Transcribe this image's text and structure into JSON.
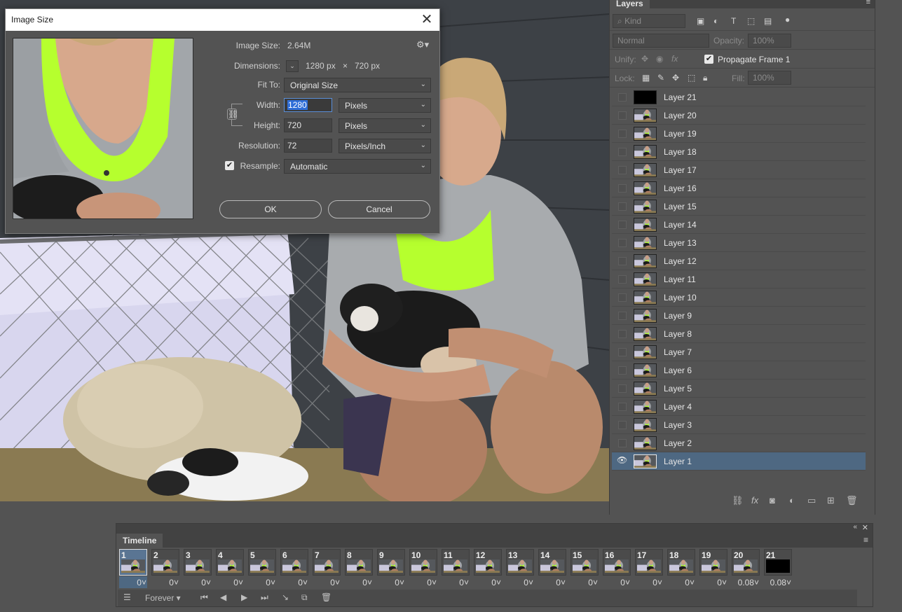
{
  "dialog": {
    "title": "Image Size",
    "image_size_label": "Image Size:",
    "image_size_value": "2.64M",
    "dimensions_label": "Dimensions:",
    "dimensions_width": "1280 px",
    "dimensions_x": "×",
    "dimensions_height": "720 px",
    "fit_to_label": "Fit To:",
    "fit_to_value": "Original Size",
    "width_label": "Width:",
    "width_value": "1280",
    "width_unit": "Pixels",
    "height_label": "Height:",
    "height_value": "720",
    "height_unit": "Pixels",
    "resolution_label": "Resolution:",
    "resolution_value": "72",
    "resolution_unit": "Pixels/Inch",
    "resample_label": "Resample:",
    "resample_value": "Automatic",
    "ok_label": "OK",
    "cancel_label": "Cancel"
  },
  "layers_panel": {
    "title": "Layers",
    "kind_placeholder": "Kind",
    "blend_mode": "Normal",
    "opacity_label": "Opacity:",
    "opacity_value": "100%",
    "unify_label": "Unify:",
    "propagate_label": "Propagate Frame 1",
    "lock_label": "Lock:",
    "fill_label": "Fill:",
    "fill_value": "100%",
    "layers": [
      {
        "name": "Layer 21",
        "thumb": "black",
        "visible": false
      },
      {
        "name": "Layer 20",
        "thumb": "photo",
        "visible": false
      },
      {
        "name": "Layer 19",
        "thumb": "photo",
        "visible": false
      },
      {
        "name": "Layer 18",
        "thumb": "photo",
        "visible": false
      },
      {
        "name": "Layer 17",
        "thumb": "photo",
        "visible": false
      },
      {
        "name": "Layer 16",
        "thumb": "photo",
        "visible": false
      },
      {
        "name": "Layer 15",
        "thumb": "photo",
        "visible": false
      },
      {
        "name": "Layer 14",
        "thumb": "photo",
        "visible": false
      },
      {
        "name": "Layer 13",
        "thumb": "photo",
        "visible": false
      },
      {
        "name": "Layer 12",
        "thumb": "photo",
        "visible": false
      },
      {
        "name": "Layer 11",
        "thumb": "photo",
        "visible": false
      },
      {
        "name": "Layer 10",
        "thumb": "photo",
        "visible": false
      },
      {
        "name": "Layer 9",
        "thumb": "photo",
        "visible": false
      },
      {
        "name": "Layer 8",
        "thumb": "photo",
        "visible": false
      },
      {
        "name": "Layer 7",
        "thumb": "photo",
        "visible": false
      },
      {
        "name": "Layer 6",
        "thumb": "photo",
        "visible": false
      },
      {
        "name": "Layer 5",
        "thumb": "photo",
        "visible": false
      },
      {
        "name": "Layer 4",
        "thumb": "photo",
        "visible": false
      },
      {
        "name": "Layer 3",
        "thumb": "photo",
        "visible": false
      },
      {
        "name": "Layer 2",
        "thumb": "photo",
        "visible": false
      },
      {
        "name": "Layer 1",
        "thumb": "photo",
        "visible": true,
        "active": true
      }
    ]
  },
  "timeline": {
    "title": "Timeline",
    "loop_value": "Forever",
    "frames": [
      {
        "num": "1",
        "delay": "0",
        "active": true
      },
      {
        "num": "2",
        "delay": "0"
      },
      {
        "num": "3",
        "delay": "0"
      },
      {
        "num": "4",
        "delay": "0"
      },
      {
        "num": "5",
        "delay": "0"
      },
      {
        "num": "6",
        "delay": "0"
      },
      {
        "num": "7",
        "delay": "0"
      },
      {
        "num": "8",
        "delay": "0"
      },
      {
        "num": "9",
        "delay": "0"
      },
      {
        "num": "10",
        "delay": "0"
      },
      {
        "num": "11",
        "delay": "0"
      },
      {
        "num": "12",
        "delay": "0"
      },
      {
        "num": "13",
        "delay": "0"
      },
      {
        "num": "14",
        "delay": "0"
      },
      {
        "num": "15",
        "delay": "0"
      },
      {
        "num": "16",
        "delay": "0"
      },
      {
        "num": "17",
        "delay": "0"
      },
      {
        "num": "18",
        "delay": "0"
      },
      {
        "num": "19",
        "delay": "0"
      },
      {
        "num": "20",
        "delay": "0.08"
      },
      {
        "num": "21",
        "delay": "0.08",
        "black": true
      }
    ]
  },
  "colors": {
    "panel_bg": "#535353",
    "panel_dark": "#424242",
    "selection": "#4e6882",
    "accent_green": "#b6ff2e"
  }
}
